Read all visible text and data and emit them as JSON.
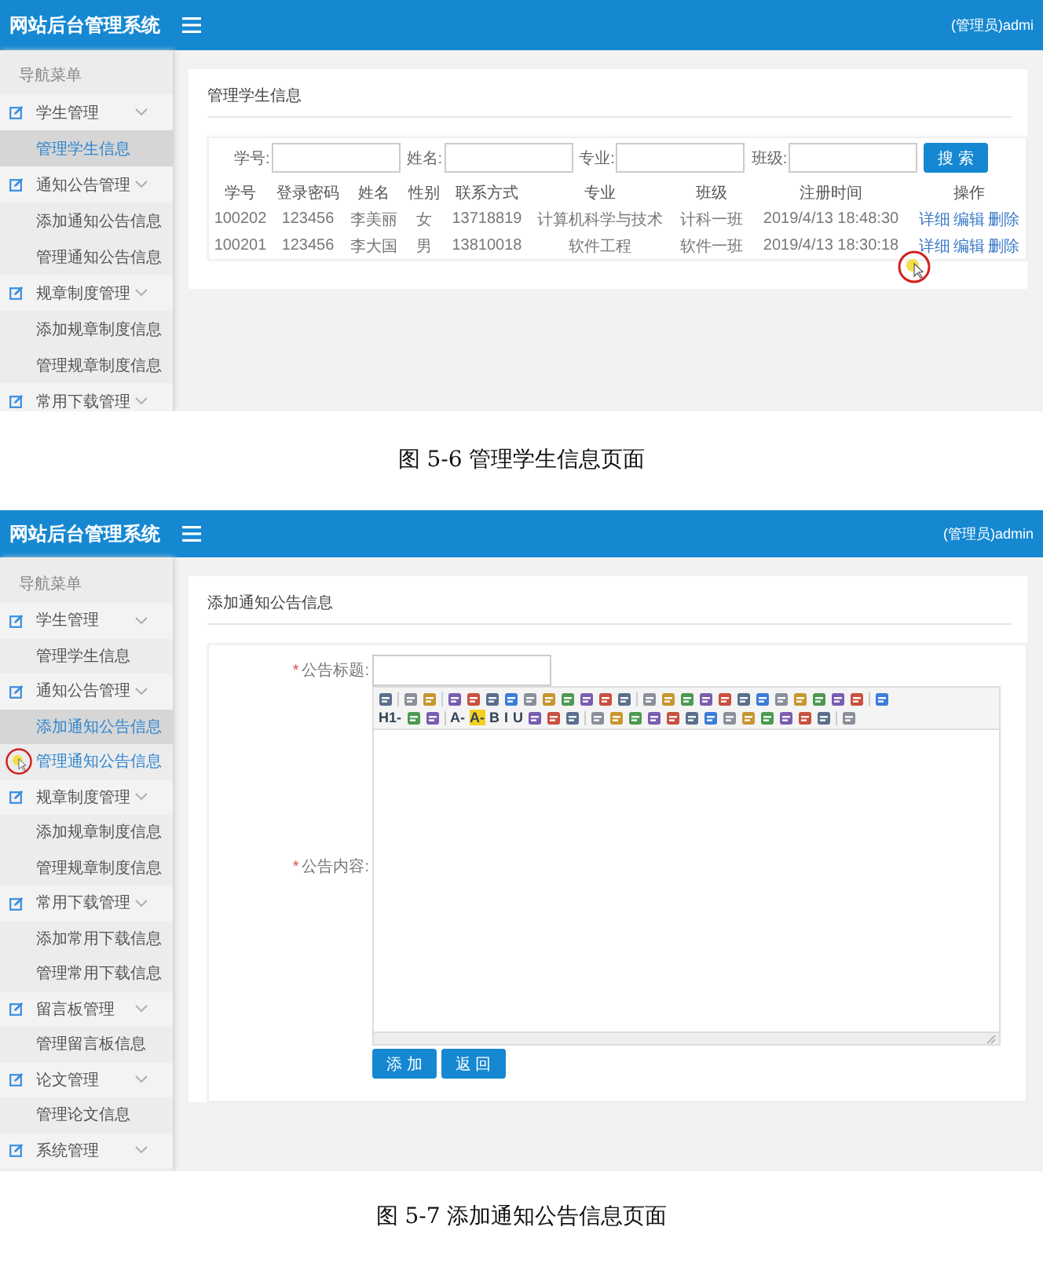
{
  "figures": [
    {
      "app": {
        "title": "网站后台管理系统",
        "user": "(管理员)admi"
      },
      "sidebar": {
        "heading": "导航菜单",
        "groups": [
          {
            "label": "学生管理",
            "children": [
              {
                "label": "管理学生信息",
                "selected": true,
                "cursor": false
              }
            ]
          },
          {
            "label": "通知公告管理",
            "children": [
              {
                "label": "添加通知公告信息",
                "selected": false,
                "cursor": false
              },
              {
                "label": "管理通知公告信息",
                "selected": false,
                "cursor": false
              }
            ]
          },
          {
            "label": "规章制度管理",
            "children": [
              {
                "label": "添加规章制度信息",
                "selected": false,
                "cursor": false
              },
              {
                "label": "管理规章制度信息",
                "selected": false,
                "cursor": false
              }
            ]
          },
          {
            "label": "常用下载管理"
          }
        ]
      },
      "content": {
        "kind": "student-list",
        "title": "管理学生信息",
        "search": [
          "学号:",
          "姓名:",
          "专业:",
          "班级:"
        ],
        "search_button": "搜 索",
        "columns": [
          "学号",
          "登录密码",
          "姓名",
          "性别",
          "联系方式",
          "专业",
          "班级",
          "注册时间",
          "操作"
        ],
        "rows": [
          {
            "cells": [
              "100202",
              "123456",
              "李美丽",
              "女",
              "13718819",
              "计算机科学与技术",
              "计科一班",
              "2019/4/13 18:48:30"
            ],
            "actions": [
              {
                "label": "详细",
                "cursor": false
              },
              {
                "label": "编辑",
                "cursor": false
              },
              {
                "label": "删除",
                "cursor": false
              }
            ]
          },
          {
            "cells": [
              "100201",
              "123456",
              "李大国",
              "男",
              "13810018",
              "软件工程",
              "软件一班",
              "2019/4/13 18:30:18"
            ],
            "actions": [
              {
                "label": "详细",
                "cursor": true
              },
              {
                "label": "编辑",
                "cursor": false
              },
              {
                "label": "删除",
                "cursor": false
              }
            ]
          }
        ]
      },
      "caption": "图 5-6 管理学生信息页面"
    },
    {
      "app": {
        "title": "网站后台管理系统",
        "user": "(管理员)admin"
      },
      "sidebar": {
        "heading": "导航菜单",
        "groups": [
          {
            "label": "学生管理",
            "children": [
              {
                "label": "管理学生信息",
                "selected": false,
                "cursor": false
              }
            ]
          },
          {
            "label": "通知公告管理",
            "children": [
              {
                "label": "添加通知公告信息",
                "selected": true,
                "cursor": false
              },
              {
                "label": "管理通知公告信息",
                "selected": false,
                "cursor": true
              }
            ]
          },
          {
            "label": "规章制度管理",
            "children": [
              {
                "label": "添加规章制度信息",
                "selected": false,
                "cursor": false
              },
              {
                "label": "管理规章制度信息",
                "selected": false,
                "cursor": false
              }
            ]
          },
          {
            "label": "常用下载管理",
            "children": [
              {
                "label": "添加常用下载信息",
                "selected": false,
                "cursor": false
              },
              {
                "label": "管理常用下载信息",
                "selected": false,
                "cursor": false
              }
            ]
          },
          {
            "label": "留言板管理",
            "children": [
              {
                "label": "管理留言板信息",
                "selected": false,
                "cursor": false
              }
            ]
          },
          {
            "label": "论文管理",
            "children": [
              {
                "label": "管理论文信息",
                "selected": false,
                "cursor": false
              }
            ]
          },
          {
            "label": "系统管理"
          }
        ]
      },
      "content": {
        "kind": "notice-form",
        "title": "添加通知公告信息",
        "fields": [
          {
            "mark": "*",
            "label": "公告标题:",
            "kind": "input"
          },
          {
            "mark": "*",
            "label": "公告内容:",
            "kind": "editor"
          }
        ],
        "toolbar": [
          [
            {
              "kind": "icon"
            },
            {
              "kind": "sep"
            },
            {
              "kind": "icon"
            },
            {
              "kind": "icon"
            },
            {
              "kind": "sep"
            },
            {
              "kind": "icon"
            },
            {
              "kind": "icon"
            },
            {
              "kind": "icon"
            },
            {
              "kind": "icon"
            },
            {
              "kind": "icon"
            },
            {
              "kind": "icon"
            },
            {
              "kind": "icon"
            },
            {
              "kind": "icon"
            },
            {
              "kind": "icon"
            },
            {
              "kind": "icon"
            },
            {
              "kind": "sep"
            },
            {
              "kind": "icon"
            },
            {
              "kind": "icon"
            },
            {
              "kind": "icon"
            },
            {
              "kind": "icon"
            },
            {
              "kind": "icon"
            },
            {
              "kind": "icon"
            },
            {
              "kind": "icon"
            },
            {
              "kind": "icon"
            },
            {
              "kind": "icon"
            },
            {
              "kind": "icon"
            },
            {
              "kind": "icon"
            },
            {
              "kind": "icon"
            },
            {
              "kind": "sep"
            },
            {
              "kind": "icon"
            }
          ],
          [
            {
              "kind": "text",
              "label": "H1-"
            },
            {
              "kind": "icon"
            },
            {
              "kind": "icon"
            },
            {
              "kind": "sep"
            },
            {
              "kind": "text",
              "label": "A-"
            },
            {
              "kind": "highlight",
              "label": "A-"
            },
            {
              "kind": "text",
              "label": "B"
            },
            {
              "kind": "text",
              "label": "I"
            },
            {
              "kind": "text",
              "label": "U"
            },
            {
              "kind": "icon"
            },
            {
              "kind": "icon"
            },
            {
              "kind": "icon"
            },
            {
              "kind": "sep"
            },
            {
              "kind": "icon"
            },
            {
              "kind": "icon"
            },
            {
              "kind": "icon"
            },
            {
              "kind": "icon"
            },
            {
              "kind": "icon"
            },
            {
              "kind": "icon"
            },
            {
              "kind": "icon"
            },
            {
              "kind": "icon"
            },
            {
              "kind": "icon"
            },
            {
              "kind": "icon"
            },
            {
              "kind": "icon"
            },
            {
              "kind": "icon"
            },
            {
              "kind": "icon"
            },
            {
              "kind": "sep"
            },
            {
              "kind": "icon"
            }
          ]
        ],
        "buttons": [
          "添 加",
          "返 回"
        ]
      },
      "caption": "图 5-7 添加通知公告信息页面"
    }
  ]
}
